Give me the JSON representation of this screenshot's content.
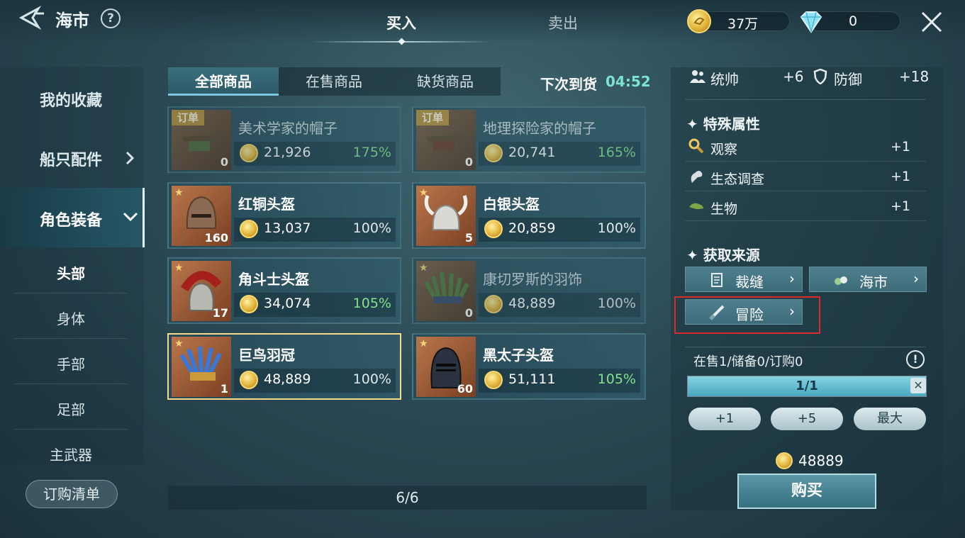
{
  "header": {
    "title": "海市",
    "help": "?",
    "tabs": [
      {
        "label": "买入",
        "active": true
      },
      {
        "label": "卖出",
        "active": false
      }
    ],
    "gold": "37万",
    "diamonds": "0"
  },
  "sidebar": {
    "items": [
      "我的收藏",
      "船只配件",
      "角色装备"
    ],
    "subitems": [
      "头部",
      "身体",
      "手部",
      "足部",
      "主武器"
    ],
    "order_list": "订购清单"
  },
  "filters": {
    "tabs": [
      "全部商品",
      "在售商品",
      "缺货商品"
    ],
    "restock_label": "下次到货",
    "restock_time": "04:52"
  },
  "items": [
    {
      "name": "美术学家的帽子",
      "price": "21,926",
      "pct": "175%",
      "qty": "0",
      "badge": "订单"
    },
    {
      "name": "地理探险家的帽子",
      "price": "20,741",
      "pct": "165%",
      "qty": "0",
      "badge": "订单"
    },
    {
      "name": "红铜头盔",
      "price": "13,037",
      "pct": "100%",
      "qty": "160"
    },
    {
      "name": "白银头盔",
      "price": "20,859",
      "pct": "100%",
      "qty": "5"
    },
    {
      "name": "角斗士头盔",
      "price": "34,074",
      "pct": "105%",
      "qty": "17"
    },
    {
      "name": "康切罗斯的羽饰",
      "price": "48,889",
      "pct": "100%",
      "qty": "0"
    },
    {
      "name": "巨鸟羽冠",
      "price": "48,889",
      "pct": "100%",
      "qty": "1"
    },
    {
      "name": "黑太子头盔",
      "price": "51,111",
      "pct": "105%",
      "qty": "60"
    }
  ],
  "pager": "6/6",
  "details": {
    "stats": [
      {
        "name": "统帅",
        "value": "+6"
      },
      {
        "name": "防御",
        "value": "+18"
      }
    ],
    "special_title": "特殊属性",
    "special": [
      {
        "name": "观察",
        "value": "+1"
      },
      {
        "name": "生态调查",
        "value": "+1"
      },
      {
        "name": "生物",
        "value": "+1"
      }
    ],
    "source_title": "获取来源",
    "sources": [
      "裁缝",
      "海市",
      "冒险"
    ],
    "stock_text": "在售1/储备0/订购0",
    "info": "!",
    "progress_text": "1/1",
    "progress": 1.0,
    "close": "✕",
    "qty_buttons": [
      "+1",
      "+5",
      "最大"
    ],
    "total": "48889",
    "buy": "购买"
  }
}
